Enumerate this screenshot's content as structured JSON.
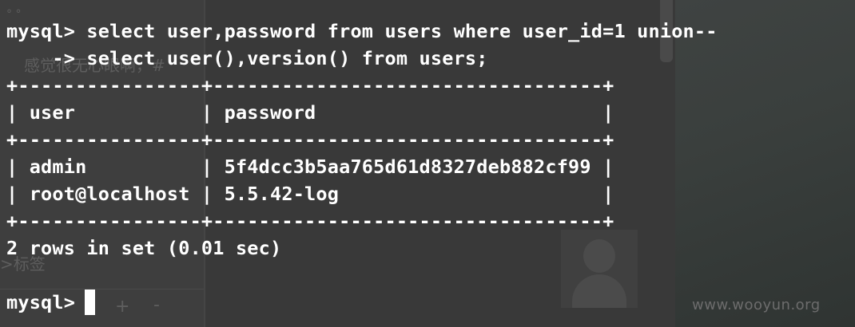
{
  "terminal": {
    "lines": [
      "mysql> select user,password from users where user_id=1 union--",
      "    -> select user(),version() from users;",
      "+----------------+----------------------------------+",
      "| user           | password                         |",
      "+----------------+----------------------------------+",
      "| admin          | 5f4dcc3b5aa765d61d8327deb882cf99 |",
      "| root@localhost | 5.5.42-log                       |",
      "+----------------+----------------------------------+",
      "2 rows in set (0.01 sec)"
    ],
    "prompt": "mysql>"
  },
  "result_table": {
    "columns": [
      "user",
      "password"
    ],
    "rows": [
      [
        "admin",
        "5f4dcc3b5aa765d61d8327deb882cf99"
      ],
      [
        "root@localhost",
        "5.5.42-log"
      ]
    ],
    "summary": "2 rows in set (0.01 sec)"
  },
  "background": {
    "ghost_text_1": "感觉很无心眼啊，#",
    "ghost_text_2": ">标签",
    "ghost_dots": "° °",
    "plus": "+",
    "minus": "-",
    "watermark": "www.wooyun.org"
  },
  "colors": {
    "terminal_bg": "#393939",
    "terminal_text": "#ffffff"
  }
}
